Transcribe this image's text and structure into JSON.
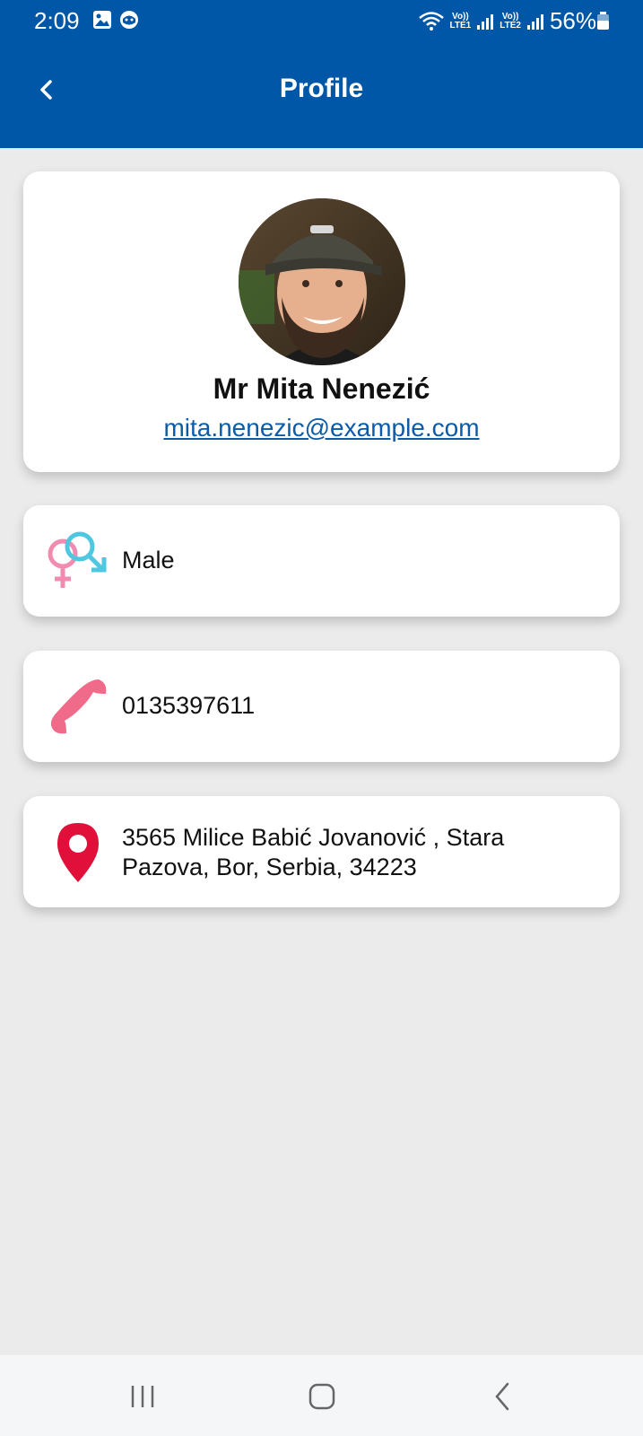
{
  "status_bar": {
    "time": "2:09",
    "battery": "56%",
    "sim1_top": "Vo))",
    "sim1_bottom": "LTE1",
    "sim2_top": "Vo))",
    "sim2_bottom": "LTE2",
    "icons": [
      "gallery-icon",
      "face-icon",
      "wifi-icon",
      "signal-icon",
      "battery-icon"
    ]
  },
  "app_bar": {
    "title": "Profile",
    "back_icon": "chevron-left-icon"
  },
  "profile": {
    "name": "Mr Mita Nenezić",
    "email": "mita.nenezic@example.com"
  },
  "info": {
    "gender": "Male",
    "phone": "0135397611",
    "address_line1": "3565 Milice Babić Jovanović , Stara",
    "address_line2": "Pazova, Bor, Serbia, 34223"
  },
  "colors": {
    "primary": "#0157a7",
    "background": "#ebebeb",
    "phone_icon": "#f06b8a",
    "location_icon": "#e0103a",
    "female_icon": "#f28bb0",
    "male_icon": "#4fc7e0"
  },
  "nav_bar": {
    "icons": [
      "recent-apps-icon",
      "home-icon",
      "back-icon"
    ]
  }
}
